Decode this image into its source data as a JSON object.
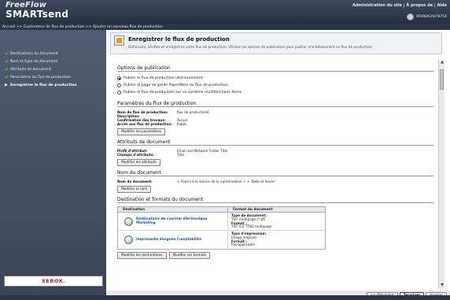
{
  "app": {
    "logo_line1": "FreeFlow",
    "logo_line2": "SMARTsend",
    "top_links": [
      "Administration du site",
      "À propos de",
      "Aide"
    ],
    "user_text": "XRXNACA078754"
  },
  "breadcrumb": "Accueil >> Explorateur de flux de production >> Ajouter un nouveau flux de production",
  "sidebar": {
    "steps": [
      {
        "label": "Destinations du document",
        "done": true
      },
      {
        "label": "Nom et type du document",
        "done": true
      },
      {
        "label": "Attributs de document",
        "done": true
      },
      {
        "label": "Paramètres du flux de production",
        "done": true
      },
      {
        "label": "Enregistrer le flux de production",
        "done": false,
        "current": true
      }
    ],
    "brand": "XEROX."
  },
  "header": {
    "title": "Enregistrer le flux de production",
    "description": "Définissez, vérifiez et enregistrez votre flux de production. Utilisez les options de publication pour publier immédiatement ce flux de production."
  },
  "publication": {
    "title": "Options de publication",
    "options": [
      {
        "label": "Publier le flux de production ultérieurement",
        "selected": true
      },
      {
        "label": "Publier la page de garde PaperWare du flux de production",
        "selected": false
      },
      {
        "label": "Publier le flux de production sur un système multifonctions Xerox",
        "selected": false
      }
    ]
  },
  "params": {
    "title": "Paramètres du flux de production",
    "rows": [
      {
        "key": "Nom du flux de production:",
        "value": "flux de production6"
      },
      {
        "key": "Description:",
        "value": ""
      },
      {
        "key": "Confirmation des travaux:",
        "value": "Aucun"
      },
      {
        "key": "Accès aux flux de production:",
        "value": "Public"
      }
    ],
    "button": "Modifier les paramètres"
  },
  "attributes": {
    "title": "Attributs de document",
    "rows": [
      {
        "key": "Profil d'attribut:",
        "value": "Email and Network Folder Title"
      },
      {
        "key": "Champs d'attributs:",
        "value": "Title"
      }
    ],
    "button": "Modifier les attributs"
  },
  "docname": {
    "title": "Nom du document",
    "rows": [
      {
        "key": "Nom du document:",
        "value": "< Fourni à la source de la numérisation > + 'Date et heure'"
      }
    ],
    "button": "Modifier le nom"
  },
  "destinations": {
    "title": "Destination et formats du document",
    "col1": "Destination",
    "col2": "Format du document",
    "rows": [
      {
        "name": "Destinataire de courrier électronique Marketing",
        "icon": "email-destination-icon",
        "lines": [
          "Type de document:",
          "TIFF multipage (*.tif)",
          "Format :",
          "TIFF 6.0 TTN2 multipage"
        ]
      },
      {
        "name": "Imprimante éloignée Comptabilité",
        "icon": "printer-destination-icon",
        "lines": [
          "Type d'impression:",
          "Image originale",
          "Format :",
          "Pas applicable"
        ]
      }
    ],
    "button1": "Modifier les destinations",
    "button2": "Modifier les formats"
  },
  "footer": {
    "prev": "<< Précédent",
    "finish": "Terminer",
    "cancel": "Annuler"
  }
}
